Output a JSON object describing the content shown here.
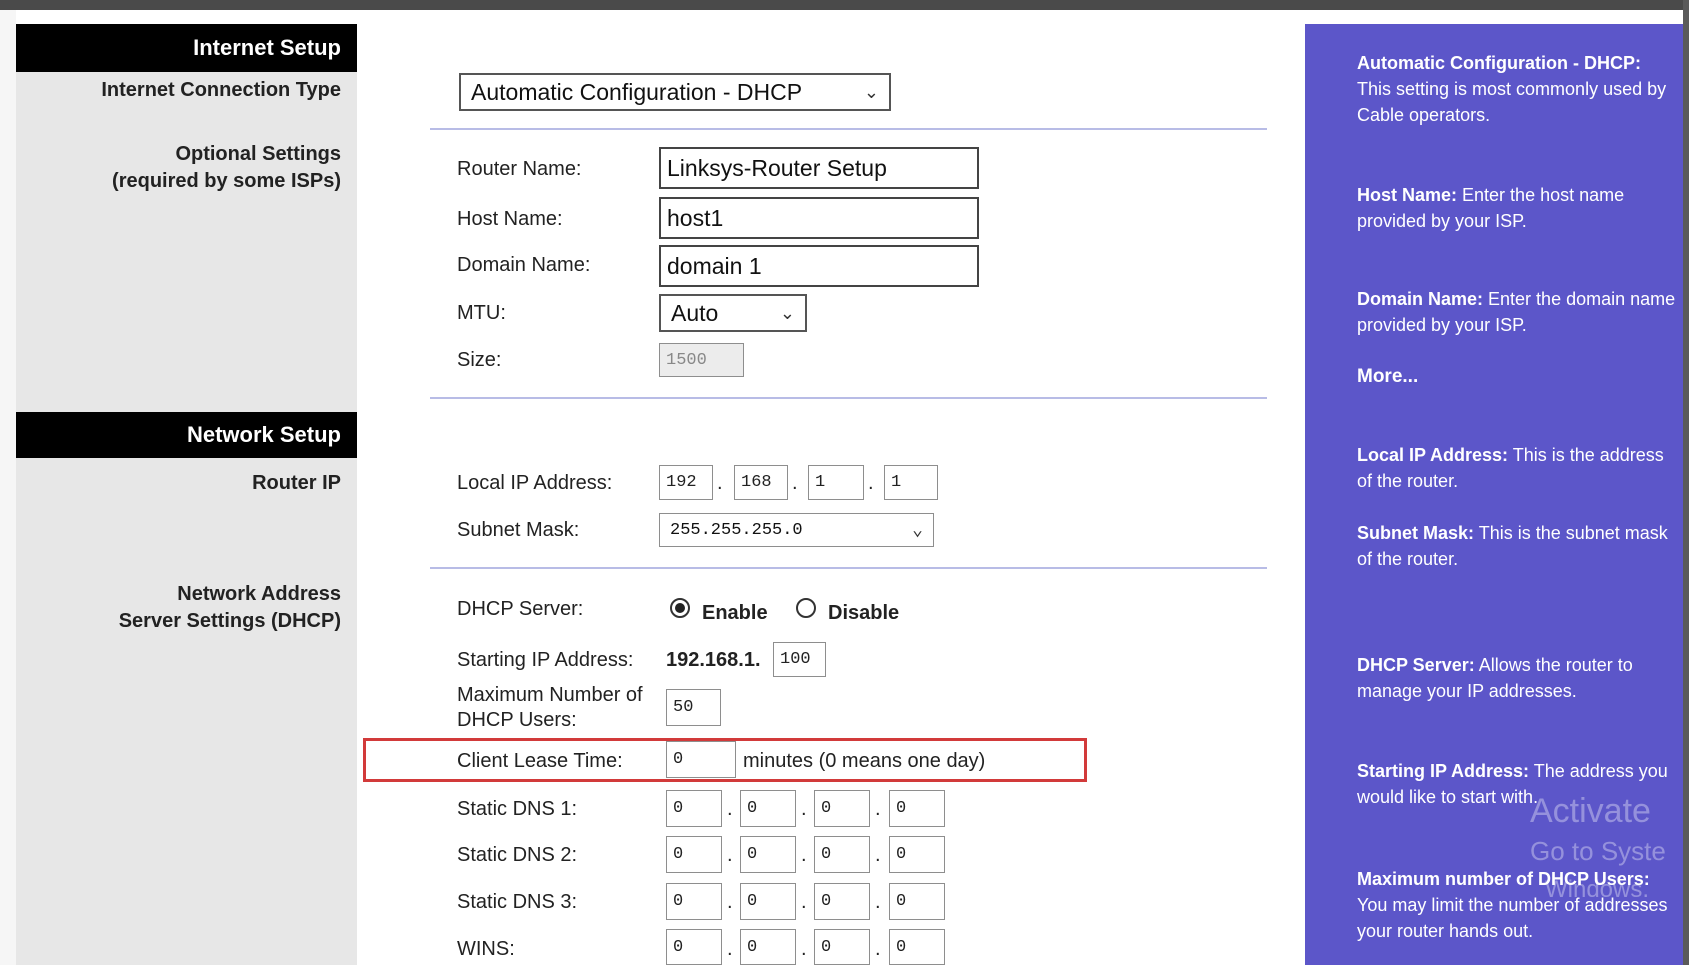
{
  "left": {
    "internet_setup": "Internet Setup",
    "connection_type_label": "Internet Connection Type",
    "optional_settings_1": "Optional Settings",
    "optional_settings_2": "(required by some ISPs)",
    "network_setup": "Network Setup",
    "router_ip_label": "Router IP",
    "nas_1": "Network Address",
    "nas_2": "Server Settings (DHCP)"
  },
  "connection": {
    "selected": "Automatic Configuration - DHCP"
  },
  "optional": {
    "router_name_label": "Router Name:",
    "router_name_value": "Linksys-Router Setup",
    "host_name_label": "Host Name:",
    "host_name_value": "host1",
    "domain_name_label": "Domain Name:",
    "domain_name_value": "domain 1",
    "mtu_label": "MTU:",
    "mtu_selected": "Auto",
    "size_label": "Size:",
    "size_value": "1500"
  },
  "router_ip": {
    "local_ip_label": "Local IP Address:",
    "local_ip": [
      "192",
      "168",
      "1",
      "1"
    ],
    "subnet_label": "Subnet Mask:",
    "subnet_selected": "255.255.255.0"
  },
  "dhcp": {
    "server_label": "DHCP Server:",
    "enable_label": "Enable",
    "disable_label": "Disable",
    "server_state": "Enable",
    "start_ip_label": "Starting IP Address:",
    "start_ip_prefix": "192.168.1.",
    "start_ip_last": "100",
    "max_users_label_1": "Maximum Number of",
    "max_users_label_2": "DHCP Users:",
    "max_users_value": "50",
    "lease_label": "Client Lease Time:",
    "lease_value": "0",
    "lease_suffix": "minutes (0 means one day)",
    "dns1_label": "Static DNS 1:",
    "dns2_label": "Static DNS 2:",
    "dns3_label": "Static DNS 3:",
    "wins_label": "WINS:",
    "dns1": [
      "0",
      "0",
      "0",
      "0"
    ],
    "dns2": [
      "0",
      "0",
      "0",
      "0"
    ],
    "dns3": [
      "0",
      "0",
      "0",
      "0"
    ],
    "wins": [
      "0",
      "0",
      "0",
      "0"
    ]
  },
  "help": {
    "auto_title": "Automatic Configuration - DHCP:",
    "auto_text": " This setting is most commonly used by Cable operators.",
    "host_title": "Host Name:",
    "host_text": " Enter the host name provided by your ISP.",
    "domain_title": "Domain Name:",
    "domain_text": " Enter the domain name provided by your ISP.",
    "more": "More...",
    "localip_title": "Local IP Address:",
    "localip_text": " This is the address of the router.",
    "subnet_title": "Subnet Mask:",
    "subnet_text": " This is the subnet mask of the router.",
    "dhcp_title": "DHCP Server:",
    "dhcp_text": " Allows the router to manage your IP addresses.",
    "startip_title": "Starting IP Address:",
    "startip_text": " The address you would like to start with.",
    "maxusers_title": "Maximum number of DHCP Users:",
    "maxusers_text": " You may limit the number of addresses your router hands out."
  },
  "watermark": {
    "line1": "Activate",
    "line2": "Go to Syste",
    "line3": "Windows."
  },
  "colors": {
    "help_bg": "#5c56c9",
    "highlight": "#d23a3a",
    "separator": "#b8bce6"
  }
}
